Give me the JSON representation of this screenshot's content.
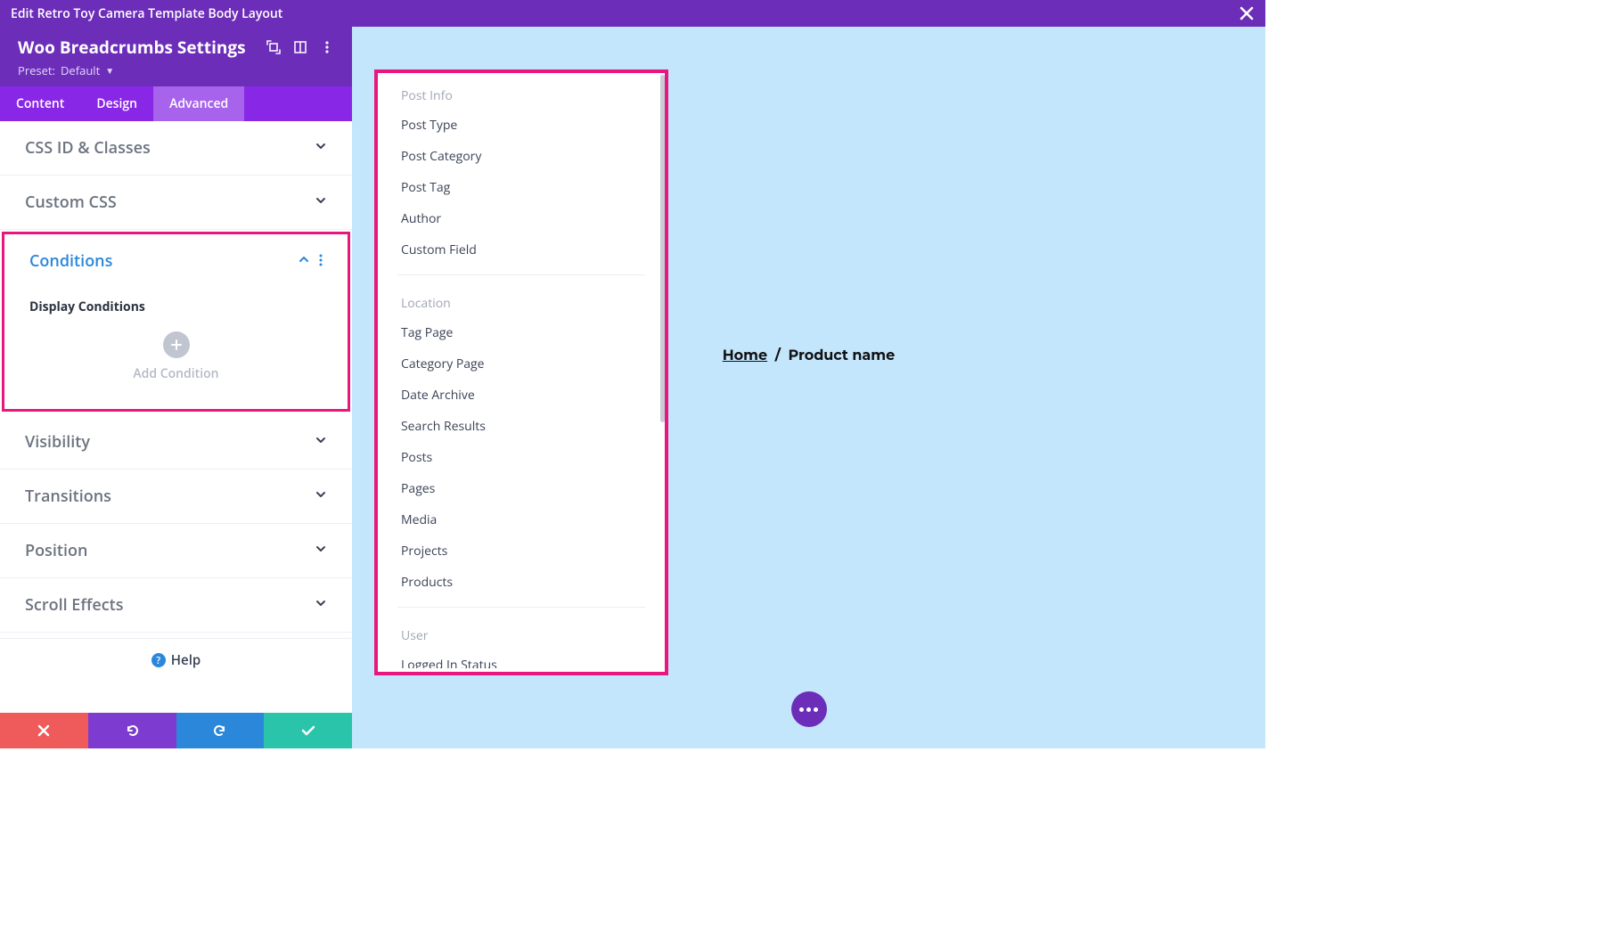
{
  "colors": {
    "purple": "#6c2eb9",
    "purple2": "#8927e6",
    "purple3": "#a763ec",
    "pink": "#e8177d",
    "blue": "#2b87da",
    "green": "#29c4a9",
    "red": "#ef5a5a",
    "canvas": "#c3e6fd"
  },
  "topbar": {
    "title": "Edit Retro Toy Camera Template Body Layout"
  },
  "panel_header": {
    "title": "Woo Breadcrumbs Settings",
    "preset_label": "Preset:",
    "preset_value": "Default"
  },
  "tabs": {
    "items": [
      "Content",
      "Design",
      "Advanced"
    ],
    "active_index": 2
  },
  "sections": {
    "css_id": "CSS ID & Classes",
    "custom_css": "Custom CSS",
    "conditions": {
      "title": "Conditions",
      "sub_label": "Display Conditions",
      "add_label": "Add Condition"
    },
    "visibility": "Visibility",
    "transitions": "Transitions",
    "position": "Position",
    "scroll_effects": "Scroll Effects"
  },
  "help_label": "Help",
  "breadcrumb": {
    "home": "Home",
    "sep": "/",
    "current": "Product name"
  },
  "popup": {
    "groups": [
      {
        "title": "Post Info",
        "items": [
          "Post Type",
          "Post Category",
          "Post Tag",
          "Author",
          "Custom Field"
        ]
      },
      {
        "title": "Location",
        "items": [
          "Tag Page",
          "Category Page",
          "Date Archive",
          "Search Results",
          "Posts",
          "Pages",
          "Media",
          "Projects",
          "Products"
        ]
      },
      {
        "title": "User",
        "items": [
          "Logged In Status"
        ]
      }
    ]
  }
}
